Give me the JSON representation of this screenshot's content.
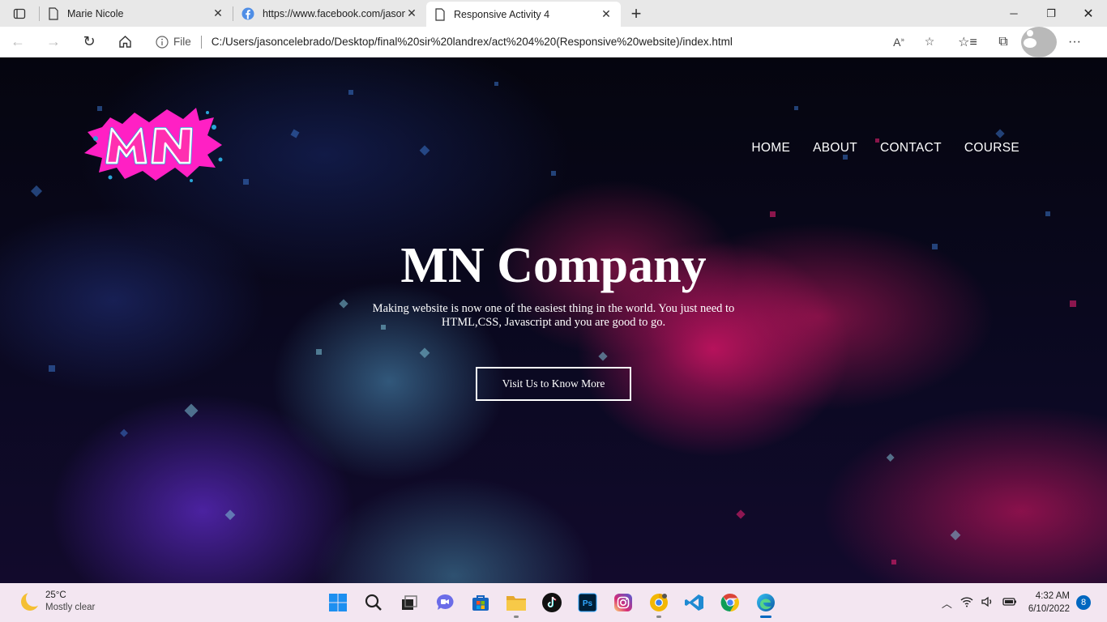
{
  "browser": {
    "tabs": [
      {
        "title": "Marie Nicole",
        "icon": "page-icon"
      },
      {
        "title": "https://www.facebook.com/jason",
        "icon": "facebook-icon"
      },
      {
        "title": "Responsive Activity 4",
        "icon": "page-icon",
        "active": true
      }
    ],
    "address": {
      "info_label": "File",
      "url": "C:/Users/jasoncelebrado/Desktop/final%20sir%20landrex/act%204%20(Responsive%20website)/index.html"
    }
  },
  "site": {
    "logo_text": "MN",
    "nav": [
      "HOME",
      "ABOUT",
      "CONTACT",
      "COURSE"
    ],
    "hero": {
      "title": "MN Company",
      "subtitle": "Making website is now one of the easiest thing in the world. You just need to HTML,CSS, Javascript and you are good to go.",
      "cta": "Visit Us to Know More"
    }
  },
  "taskbar": {
    "weather": {
      "temp": "25°C",
      "condition": "Mostly clear"
    },
    "apps": [
      "start-icon",
      "search-icon",
      "task-view-icon",
      "chat-icon",
      "store-icon",
      "file-explorer-icon",
      "tiktok-icon",
      "photoshop-icon",
      "instagram-icon",
      "chrome-canary-icon",
      "vscode-icon",
      "chrome-icon",
      "edge-icon"
    ],
    "photoshop_label": "Ps",
    "clock": {
      "time": "4:32 AM",
      "date": "6/10/2022"
    },
    "notifications": "8"
  },
  "colors": {
    "accent": "#0067c0",
    "logo_pink": "#ff2fb0",
    "logo_blue": "#2a9fd6"
  }
}
